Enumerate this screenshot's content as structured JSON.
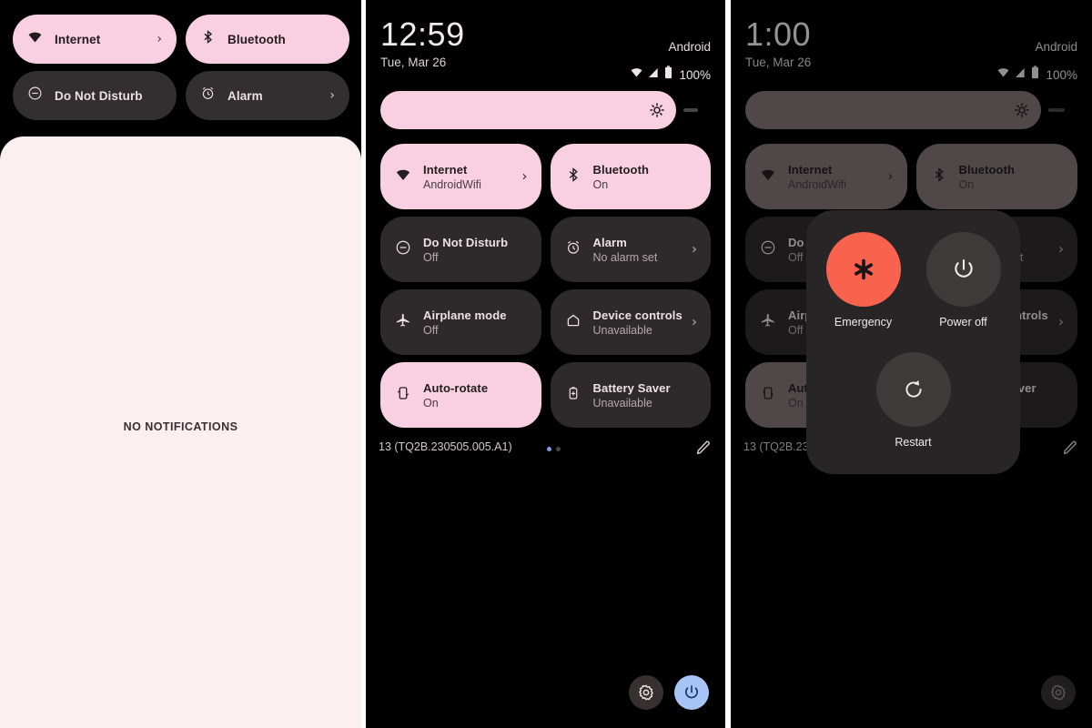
{
  "panel1": {
    "name": "quick-settings-collapsed",
    "tiles": [
      {
        "label": "Internet",
        "icon": "wifi-icon",
        "state": "on",
        "chevron": "›"
      },
      {
        "label": "Bluetooth",
        "icon": "bluetooth-icon",
        "state": "on",
        "chevron": ""
      },
      {
        "label": "Do Not Disturb",
        "icon": "do-not-disturb-icon",
        "state": "off",
        "chevron": ""
      },
      {
        "label": "Alarm",
        "icon": "alarm-icon",
        "state": "off",
        "chevron": "›"
      }
    ],
    "notifications_empty_text": "NO NOTIFICATIONS"
  },
  "panel2": {
    "name": "quick-settings-expanded",
    "status": {
      "time": "12:59",
      "date": "Tue, Mar 26",
      "carrier": "Android",
      "battery": "100%",
      "icons": [
        "wifi-icon",
        "signal-icon",
        "battery-icon"
      ]
    },
    "brightness": {
      "name": "brightness-slider",
      "icon": "brightness-icon",
      "value_percent": 82
    },
    "tiles": [
      {
        "title": "Internet",
        "sub": "AndroidWifi",
        "icon": "wifi-icon",
        "state": "on",
        "chevron": "›"
      },
      {
        "title": "Bluetooth",
        "sub": "On",
        "icon": "bluetooth-icon",
        "state": "on",
        "chevron": ""
      },
      {
        "title": "Do Not Disturb",
        "sub": "Off",
        "icon": "do-not-disturb-icon",
        "state": "off",
        "chevron": ""
      },
      {
        "title": "Alarm",
        "sub": "No alarm set",
        "icon": "alarm-icon",
        "state": "off",
        "chevron": "›"
      },
      {
        "title": "Airplane mode",
        "sub": "Off",
        "icon": "airplane-icon",
        "state": "off",
        "chevron": ""
      },
      {
        "title": "Device controls",
        "sub": "Unavailable",
        "icon": "home-icon",
        "state": "off",
        "chevron": "›"
      },
      {
        "title": "Auto-rotate",
        "sub": "On",
        "icon": "auto-rotate-icon",
        "state": "on",
        "chevron": ""
      },
      {
        "title": "Battery Saver",
        "sub": "Unavailable",
        "icon": "battery-saver-icon",
        "state": "off",
        "chevron": ""
      }
    ],
    "footer": {
      "build": "13 (TQ2B.230505.005.A1)",
      "page_dots": 2,
      "current_page": 1,
      "edit_icon": "pencil-icon"
    },
    "bottom_buttons": [
      {
        "name": "settings-button",
        "icon": "gear-icon",
        "color": "#36302f"
      },
      {
        "name": "power-button",
        "icon": "power-icon",
        "color": "#a8c4f7"
      }
    ]
  },
  "panel3": {
    "name": "quick-settings-with-power-dialog",
    "status": {
      "time": "1:00",
      "date": "Tue, Mar 26",
      "carrier": "Android",
      "battery": "100%"
    },
    "power_dialog": {
      "name": "power-menu-dialog",
      "options": [
        {
          "label": "Emergency",
          "icon": "emergency-asterisk-icon",
          "color": "#f9624d"
        },
        {
          "label": "Power off",
          "icon": "power-icon",
          "color": "#3d3a3a"
        },
        {
          "label": "Restart",
          "icon": "restart-icon",
          "color": "#3d3a3a"
        }
      ]
    },
    "bottom_buttons": [
      {
        "name": "settings-button",
        "icon": "gear-icon",
        "color": "#36302f"
      }
    ]
  },
  "annotations": [
    {
      "name": "arrow-to-power-button",
      "color": "#e81f10",
      "points_to": "power-button"
    },
    {
      "name": "arrow-to-restart",
      "color": "#e81f10",
      "points_to": "restart-button"
    }
  ],
  "colors": {
    "background": "#000000",
    "tile_active": "#f9d0e1",
    "tile_inactive": "#2e2a2b",
    "shade": "#fbeff0",
    "accent_power": "#a8c4f7",
    "emergency": "#f9624d",
    "arrow": "#e81f10"
  }
}
